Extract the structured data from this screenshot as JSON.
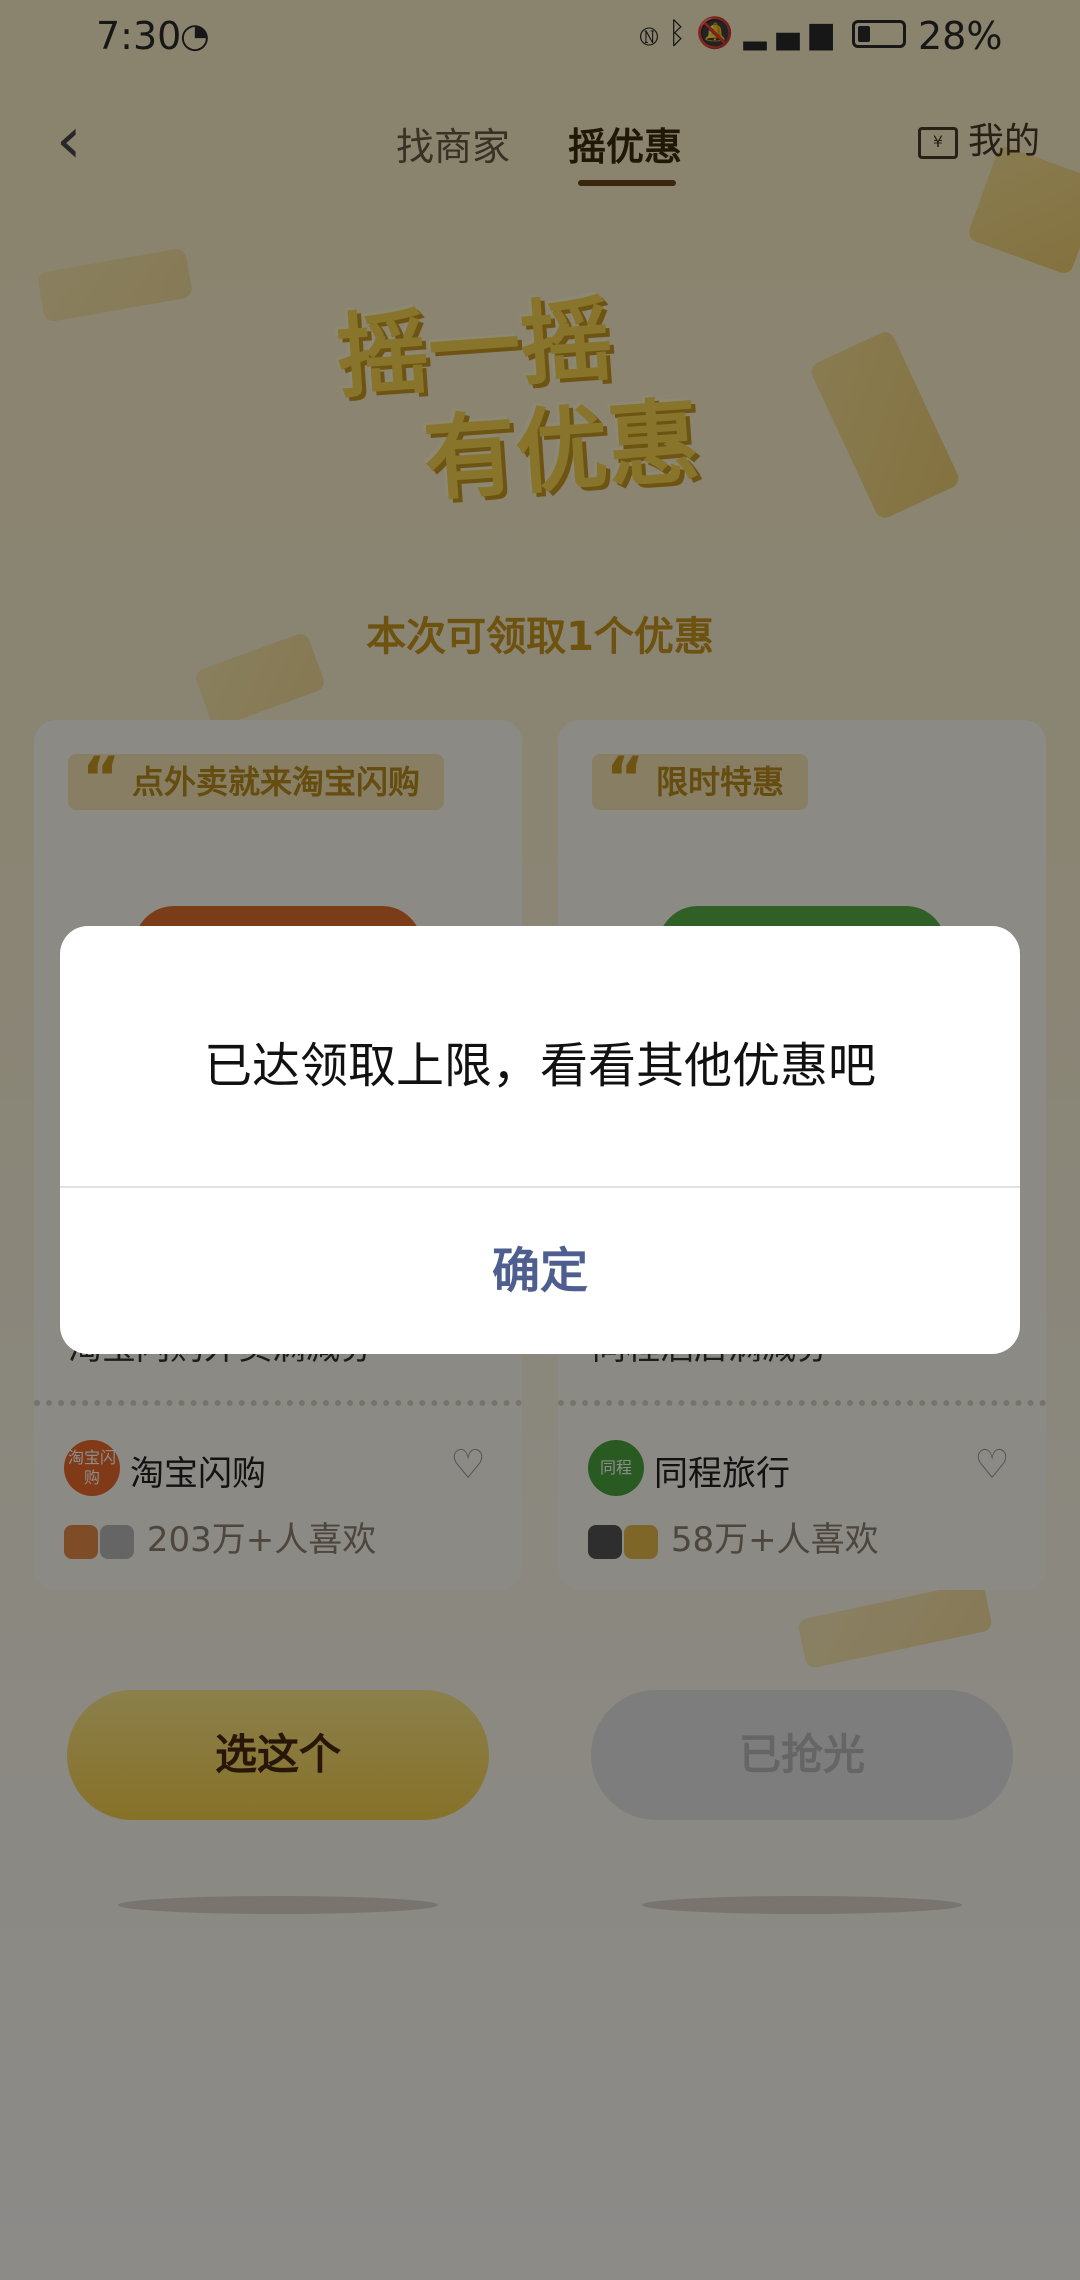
{
  "status_bar": {
    "time": "7:30",
    "battery": "28%",
    "battery_level": 0.28
  },
  "nav": {
    "back_label": "‹",
    "tabs": [
      {
        "label": "找商家"
      },
      {
        "label": "摇优惠"
      }
    ],
    "mine_label": "我的"
  },
  "hero": {
    "line1": "摇一摇",
    "line2": "有优惠"
  },
  "subtitle": "本次可领取1个优惠",
  "cards": [
    {
      "quote": "点外卖就来淘宝闪购",
      "accent_color": "#e0702a",
      "title": "淘宝闪购外卖满减券",
      "brand_logo_text": "淘宝闪购",
      "brand_color": "#ec6a2a",
      "brand_name": "淘宝闪购",
      "likes": "203万+人喜欢",
      "action": "选这个"
    },
    {
      "quote": "限时特惠",
      "accent_color": "#58b046",
      "title": "同程酒店满减券",
      "brand_logo_text": "同程",
      "brand_color": "#49a43c",
      "brand_name": "同程旅行",
      "likes": "58万+人喜欢",
      "action": "已抢光"
    }
  ],
  "dialog": {
    "message": "已达领取上限，看看其他优惠吧",
    "confirm_label": "确定"
  }
}
